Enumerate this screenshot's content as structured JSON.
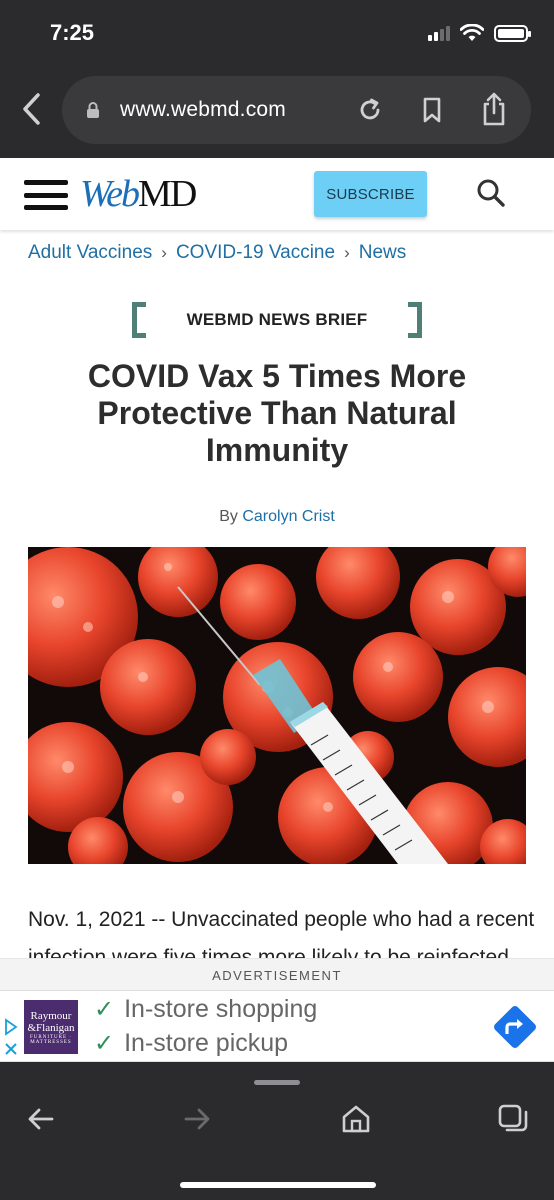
{
  "status_bar": {
    "time": "7:25"
  },
  "browser": {
    "url": "www.webmd.com"
  },
  "site_header": {
    "logo_web": "Web",
    "logo_md": "MD",
    "subscribe_label": "SUBSCRIBE"
  },
  "breadcrumb": {
    "items": [
      "Adult Vaccines",
      "COVID-19 Vaccine",
      "News"
    ]
  },
  "article": {
    "kicker": "WEBMD NEWS BRIEF",
    "headline": "COVID Vax 5 Times More Protective Than Natural Immunity",
    "byline_prefix": "By",
    "author": "Carolyn Crist",
    "date": "Nov. 1, 2021",
    "body_line_1": "Nov. 1, 2021 -- Unvaccinated people who had a recent",
    "body_line_2": "infection were five times more likely to be reinfected"
  },
  "advertisement": {
    "label": "ADVERTISEMENT",
    "brand_line_1": "Raymour",
    "brand_line_2": "&Flanigan",
    "brand_line_3": "FURNITURE · MATTRESSES",
    "feature_1": "In-store shopping",
    "feature_2": "In-store pickup"
  },
  "colors": {
    "browser_chrome": "#2b2b2d",
    "url_pill": "#3a3a3c",
    "link_blue": "#1f6fa5",
    "logo_blue": "#1b6fb8",
    "subscribe_bg": "#6dcff6",
    "bracket_green": "#4f7f76",
    "ad_brand_purple": "#4b2c6e",
    "directions_blue": "#1a73e8"
  },
  "icons": {
    "back": "chevron-left-icon",
    "lock": "lock-icon",
    "reload": "reload-icon",
    "bookmark": "bookmark-icon",
    "share": "share-icon",
    "menu": "hamburger-icon",
    "search": "search-icon",
    "tabs": "tabs-icon",
    "home": "home-icon"
  }
}
